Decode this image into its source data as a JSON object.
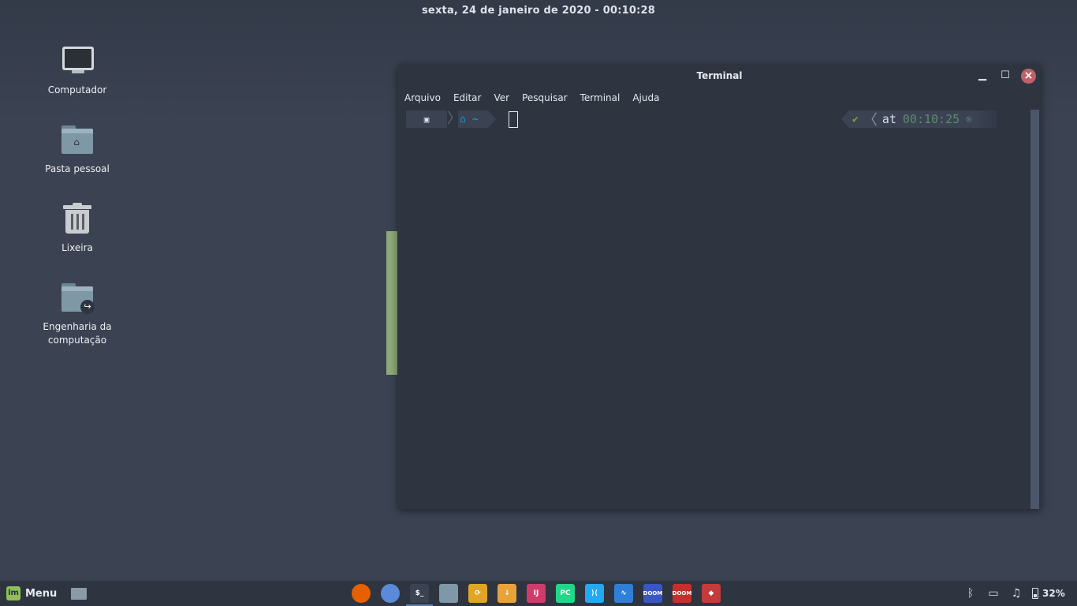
{
  "topbar": {
    "datetime": "sexta, 24 de janeiro de 2020 - 00:10:28"
  },
  "desktop": {
    "icons": [
      {
        "label": "Computador",
        "icon": "computer-icon"
      },
      {
        "label": "Pasta pessoal",
        "icon": "home-folder-icon"
      },
      {
        "label": "Lixeira",
        "icon": "trash-icon"
      },
      {
        "label": "Engenharia da computação",
        "icon": "folder-link-icon"
      }
    ]
  },
  "terminal": {
    "title": "Terminal",
    "menu": [
      "Arquivo",
      "Editar",
      "Ver",
      "Pesquisar",
      "Terminal",
      "Ajuda"
    ],
    "prompt": {
      "home_glyph": "⌂",
      "dir": "~",
      "status_ok": "✔",
      "at": "at",
      "time": "00:10:25",
      "clock_glyph": "⊙"
    }
  },
  "taskbar": {
    "menu_label": "Menu",
    "launchers": [
      {
        "name": "firefox",
        "color": "#e66000",
        "glyph": ""
      },
      {
        "name": "chromium",
        "color": "#5b8ad8",
        "glyph": ""
      },
      {
        "name": "terminal",
        "color": "#3b4252",
        "glyph": "$_"
      },
      {
        "name": "files",
        "color": "#7e98a6",
        "glyph": ""
      },
      {
        "name": "sync",
        "color": "#e0a526",
        "glyph": "⟳"
      },
      {
        "name": "download",
        "color": "#e8a23a",
        "glyph": "↓"
      },
      {
        "name": "intellij",
        "color": "#d13b6b",
        "glyph": "IJ"
      },
      {
        "name": "pycharm",
        "color": "#21d789",
        "glyph": "PC"
      },
      {
        "name": "vscode",
        "color": "#23a9f2",
        "glyph": "⟩⟨"
      },
      {
        "name": "monitor",
        "color": "#2f7ed8",
        "glyph": "∿"
      },
      {
        "name": "doom-blue",
        "color": "#3a56c5",
        "glyph": "DOOM"
      },
      {
        "name": "doom-red",
        "color": "#c5302c",
        "glyph": "DOOM"
      },
      {
        "name": "ruby",
        "color": "#c43b3b",
        "glyph": "◆"
      }
    ],
    "tray": {
      "battery_percent": "32%"
    }
  }
}
